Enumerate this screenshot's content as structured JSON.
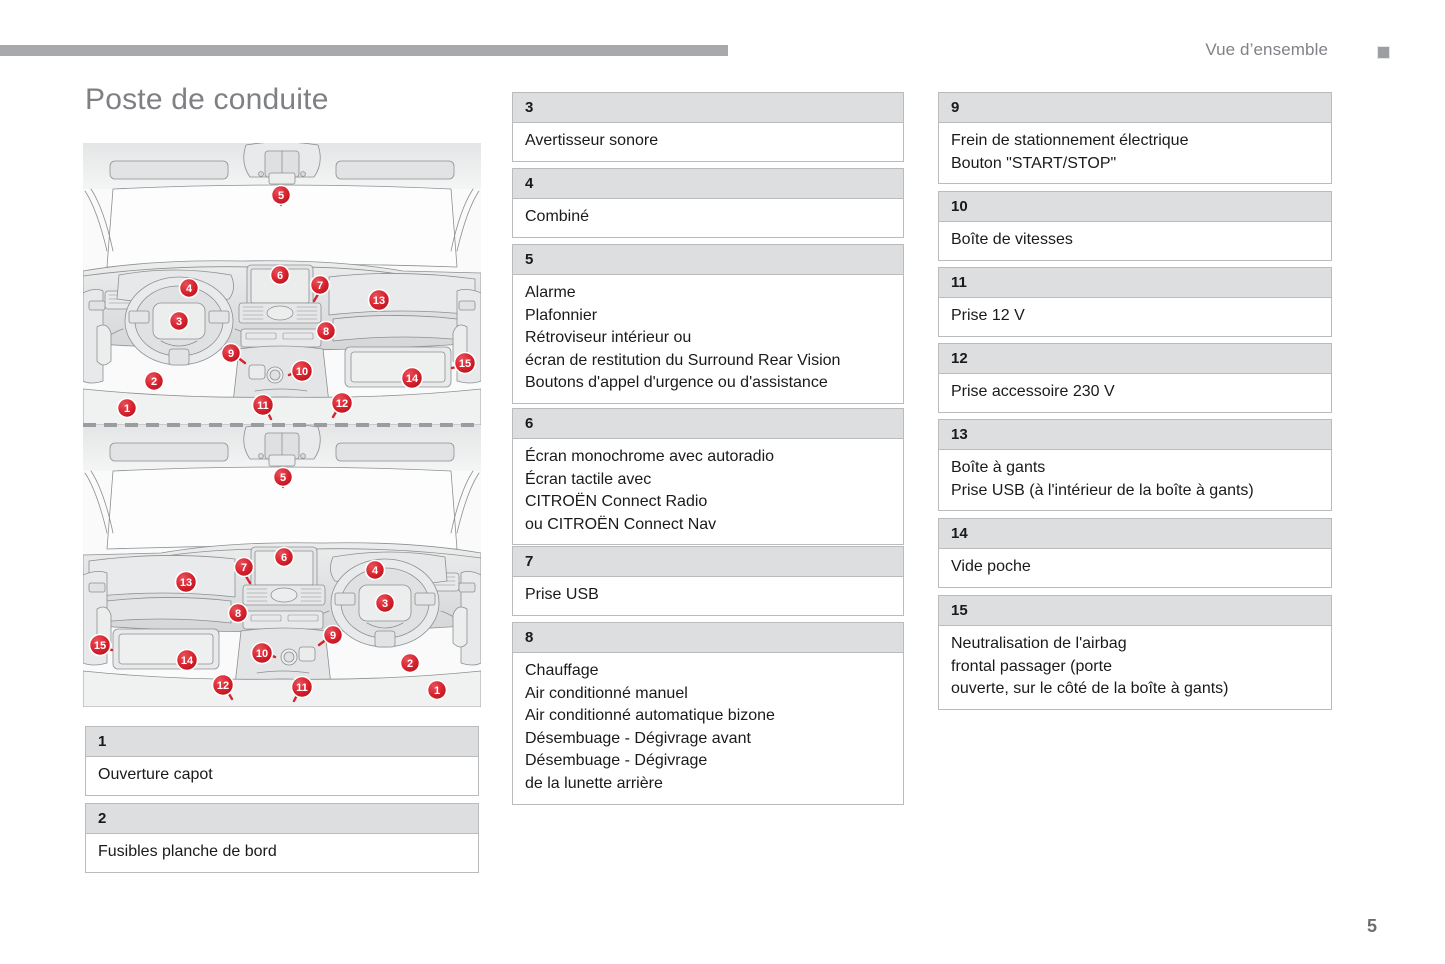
{
  "header": {
    "section_title": "Vue d’ensemble",
    "marker_icon": "square-marker-icon",
    "bar_color": "#a7a9ac"
  },
  "page": {
    "title": "Poste de conduite",
    "number": "5",
    "title_color": "#7e8083"
  },
  "illustrations": [
    {
      "name": "dashboard-overview-left-hand-drive",
      "callouts": [
        "1",
        "2",
        "3",
        "4",
        "5",
        "6",
        "7",
        "8",
        "9",
        "10",
        "11",
        "12",
        "13",
        "14",
        "15"
      ],
      "callout_color": "#d8222e"
    },
    {
      "name": "dashboard-overview-right-hand-drive",
      "callouts": [
        "1",
        "2",
        "3",
        "4",
        "5",
        "6",
        "7",
        "8",
        "9",
        "10",
        "11",
        "12",
        "13",
        "14",
        "15"
      ],
      "callout_color": "#d8222e"
    }
  ],
  "items": {
    "i1": {
      "number": "1",
      "text": "Ouverture capot"
    },
    "i2": {
      "number": "2",
      "text": "Fusibles planche de bord"
    },
    "i3": {
      "number": "3",
      "text": "Avertisseur sonore"
    },
    "i4": {
      "number": "4",
      "text": "Combiné"
    },
    "i5": {
      "number": "5",
      "text": "Alarme\nPlafonnier\nRétroviseur intérieur ou\nécran de restitution du Surround Rear Vision\nBoutons d'appel d'urgence ou d'assistance"
    },
    "i6": {
      "number": "6",
      "text": "Écran monochrome avec autoradio\nÉcran tactile avec\nCITROËN Connect Radio\nou CITROËN Connect Nav"
    },
    "i7": {
      "number": "7",
      "text": "Prise USB"
    },
    "i8": {
      "number": "8",
      "text": "Chauffage\nAir conditionné manuel\nAir conditionné automatique bizone\nDésembuage - Dégivrage avant\nDésembuage - Dégivrage\nde la lunette arrière"
    },
    "i9": {
      "number": "9",
      "text": "Frein de stationnement électrique\nBouton \"START/STOP\""
    },
    "i10": {
      "number": "10",
      "text": "Boîte de vitesses"
    },
    "i11": {
      "number": "11",
      "text": "Prise 12 V"
    },
    "i12": {
      "number": "12",
      "text": "Prise accessoire 230 V"
    },
    "i13": {
      "number": "13",
      "text": "Boîte à gants\nPrise USB (à l'intérieur de la boîte à gants)"
    },
    "i14": {
      "number": "14",
      "text": "Vide poche"
    },
    "i15": {
      "number": "15",
      "text": "Neutralisation de l'airbag\nfrontal passager (porte\nouverte, sur le côté de la boîte à gants)"
    }
  }
}
